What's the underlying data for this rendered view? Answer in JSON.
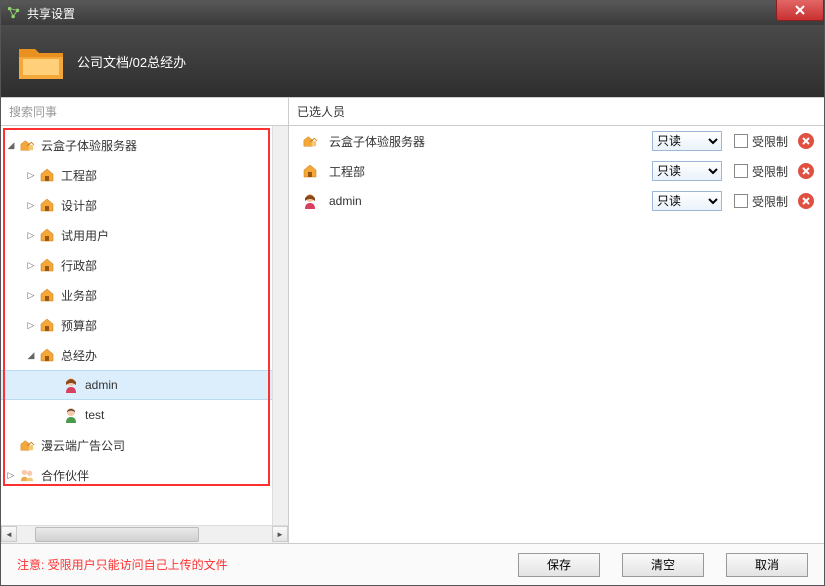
{
  "window": {
    "title": "共享设置",
    "breadcrumb": "公司文档/02总经办"
  },
  "left": {
    "search_placeholder": "搜索同事",
    "tree": [
      {
        "label": "云盒子体验服务器",
        "indent": 1,
        "expanded": true,
        "icon": "org"
      },
      {
        "label": "工程部",
        "indent": 2,
        "expanded": false,
        "icon": "home"
      },
      {
        "label": "设计部",
        "indent": 2,
        "expanded": false,
        "icon": "home"
      },
      {
        "label": "试用用户",
        "indent": 2,
        "expanded": false,
        "icon": "home"
      },
      {
        "label": "行政部",
        "indent": 2,
        "expanded": false,
        "icon": "home"
      },
      {
        "label": "业务部",
        "indent": 2,
        "expanded": false,
        "icon": "home"
      },
      {
        "label": "预算部",
        "indent": 2,
        "expanded": false,
        "icon": "home"
      },
      {
        "label": "总经办",
        "indent": 2,
        "expanded": true,
        "icon": "home"
      },
      {
        "label": "admin",
        "indent": 3,
        "expanded": null,
        "icon": "user-f",
        "selected": true
      },
      {
        "label": "test",
        "indent": 3,
        "expanded": null,
        "icon": "user-m"
      },
      {
        "label": "漫云端广告公司",
        "indent": 1,
        "expanded": null,
        "icon": "org"
      },
      {
        "label": "合作伙伴",
        "indent": 1,
        "expanded": false,
        "icon": "partner"
      }
    ]
  },
  "right": {
    "header": "已选人员",
    "perm_label": "只读",
    "restrict_label": "受限制",
    "rows": [
      {
        "label": "云盒子体验服务器",
        "icon": "org"
      },
      {
        "label": "工程部",
        "icon": "home"
      },
      {
        "label": "admin",
        "icon": "user-f"
      }
    ]
  },
  "footer": {
    "note": "注意: 受限用户只能访问自己上传的文件",
    "save": "保存",
    "clear": "清空",
    "cancel": "取消"
  }
}
